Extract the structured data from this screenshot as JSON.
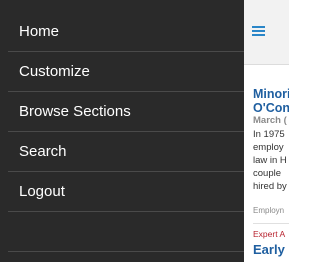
{
  "menu": {
    "items": [
      {
        "label": "Home"
      },
      {
        "label": "Customize"
      },
      {
        "label": "Browse Sections"
      },
      {
        "label": "Search"
      },
      {
        "label": "Logout"
      },
      {
        "label": ""
      }
    ]
  },
  "content": {
    "article1": {
      "title_line1": "Minori",
      "title_line2": "O'Con",
      "date": "March (",
      "body": [
        "In 1975",
        "employ",
        "law in H",
        "couple",
        "hired by"
      ],
      "tag": "Employn"
    },
    "article2": {
      "kicker": "Expert A",
      "title": "Early I"
    }
  },
  "colors": {
    "drawer_bg": "#2a2a2a",
    "accent": "#2a86c8",
    "title_blue": "#1f5fa0",
    "expert_red": "#b8232f"
  },
  "icons": {
    "menu": "hamburger-icon"
  }
}
